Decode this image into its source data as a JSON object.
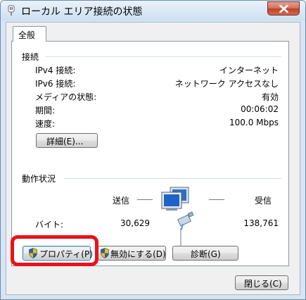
{
  "window": {
    "title": "ローカル エリア接続の状態"
  },
  "tabs": [
    {
      "label": "全般"
    }
  ],
  "connection": {
    "heading": "接続",
    "rows": [
      {
        "label": "IPv4 接続:",
        "value": "インターネット"
      },
      {
        "label": "IPv6 接続:",
        "value": "ネットワーク アクセスなし"
      },
      {
        "label": "メディアの状態:",
        "value": "有効"
      },
      {
        "label": "期間:",
        "value": "00:06:02"
      },
      {
        "label": "速度:",
        "value": "100.0 Mbps"
      }
    ],
    "details_button": "詳細(E)..."
  },
  "activity": {
    "heading": "動作状況",
    "sent_label": "送信",
    "received_label": "受信",
    "bytes_label": "バイト:",
    "bytes_sent": "30,629",
    "bytes_received": "138,761"
  },
  "actions": {
    "properties": "プロパティ(P)",
    "disable": "無効にする(D)",
    "diagnose": "診断(G)"
  },
  "footer": {
    "close": "閉じる(C)"
  },
  "colors": {
    "highlight": "#e8121a",
    "shield_blue": "#2a5db0",
    "shield_yellow": "#f3c200"
  }
}
